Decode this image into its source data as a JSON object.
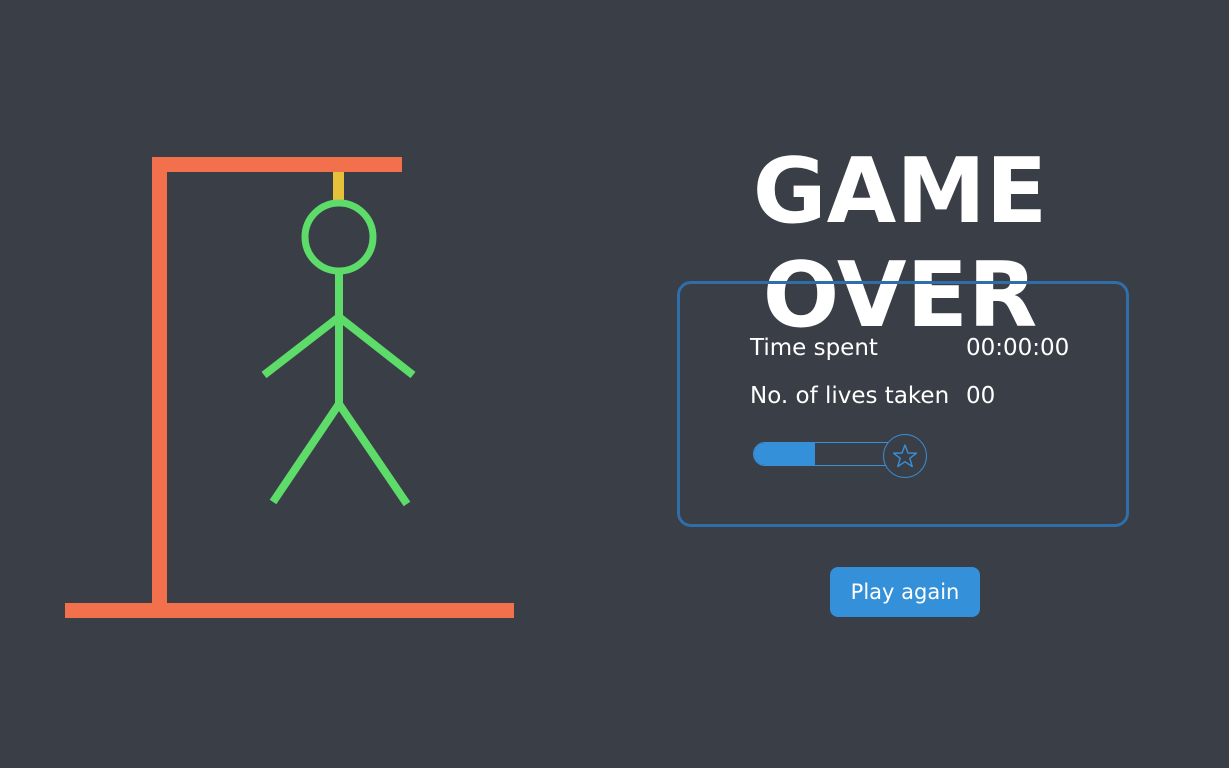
{
  "title": "GAME OVER",
  "stats": {
    "time_label": "Time spent",
    "time_value": "00:00:00",
    "lives_label": "No. of lives taken",
    "lives_value": "00"
  },
  "progress": {
    "fraction": 0.41,
    "badge_icon": "star-icon"
  },
  "play_again_label": "Play again",
  "colors": {
    "background": "#3a3e47",
    "gallows": "#f2714c",
    "rope": "#e6c23a",
    "figure": "#5ddc6a",
    "panel_border": "#2f6ea8",
    "accent": "#3490d8"
  }
}
